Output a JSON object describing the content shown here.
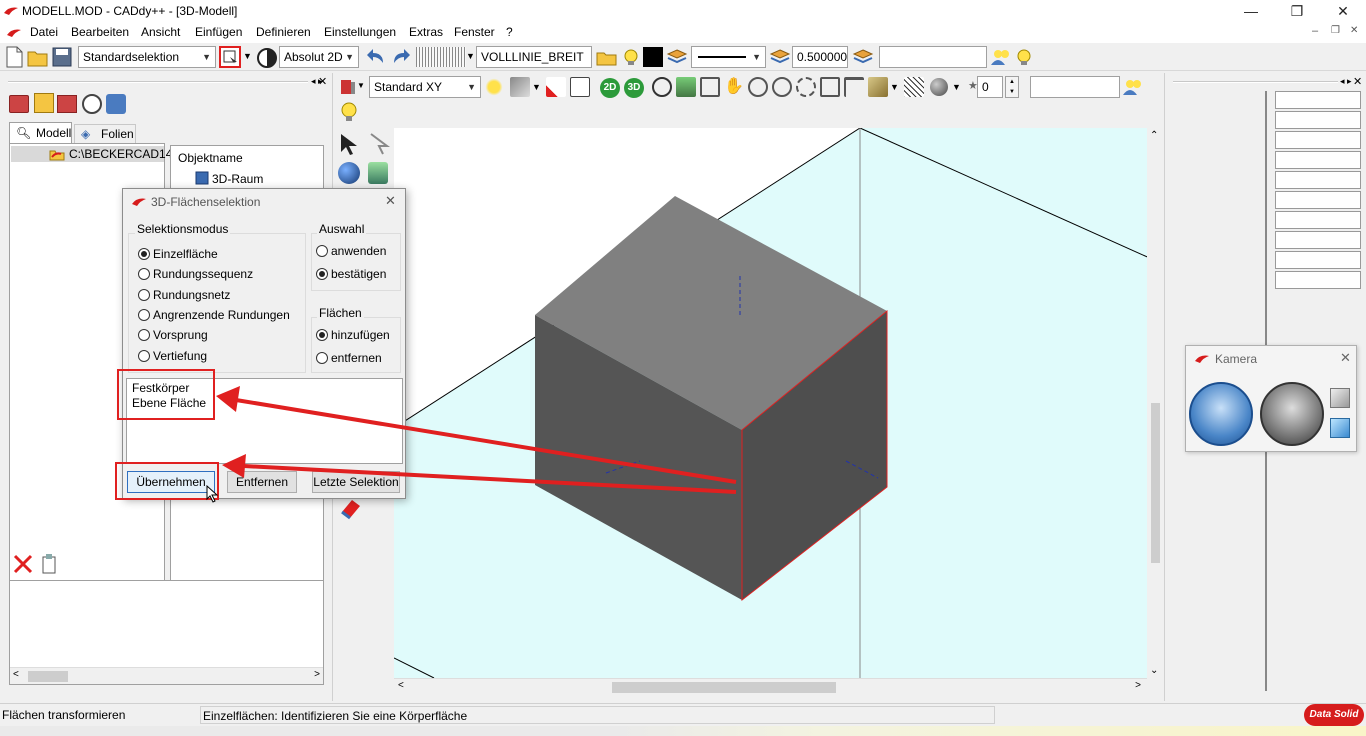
{
  "window": {
    "title": "MODELL.MOD  -  CADdy++ - [3D-Modell]",
    "minimize": "—",
    "restore": "❐",
    "close": "✕"
  },
  "menu": {
    "items": [
      "Datei",
      "Bearbeiten",
      "Ansicht",
      "Einfügen",
      "Definieren",
      "Einstellungen",
      "Extras",
      "Fenster",
      "?"
    ],
    "mdi_min": "–",
    "mdi_restore": "❐",
    "mdi_close": "✕"
  },
  "toolbar": {
    "selection_mode": "Standardselektion",
    "coord_mode": "Absolut 2D",
    "linetype": "VOLLLINIE_BREIT",
    "line_width": "0.500000",
    "layer_value": ""
  },
  "viewport_toolbar": {
    "view": "Standard XY",
    "btn_2d": "2D",
    "btn_3d": "3D",
    "spinner_value": "0",
    "input_value": ""
  },
  "left_panel": {
    "tabs": [
      "Modell",
      "Folien"
    ],
    "tree_root": "C:\\BECKERCAD14",
    "object_header": "Objektname",
    "object_item": "3D-Raum"
  },
  "dialog": {
    "title": "3D-Flächenselektion",
    "group_mode": "Selektionsmodus",
    "modes": [
      {
        "label": "Einzelfläche",
        "checked": true
      },
      {
        "label": "Rundungssequenz",
        "checked": false
      },
      {
        "label": "Rundungsnetz",
        "checked": false
      },
      {
        "label": "Angrenzende Rundungen",
        "checked": false
      },
      {
        "label": "Vorsprung",
        "checked": false
      },
      {
        "label": "Vertiefung",
        "checked": false
      }
    ],
    "group_auswahl": "Auswahl",
    "auswahl": [
      {
        "label": "anwenden",
        "checked": false
      },
      {
        "label": "bestätigen",
        "checked": true
      }
    ],
    "group_flaechen": "Flächen",
    "flaechen": [
      {
        "label": "hinzufügen",
        "checked": true
      },
      {
        "label": "entfernen",
        "checked": false
      }
    ],
    "list_lines": [
      "Festkörper",
      "Ebene Fläche"
    ],
    "btn_apply": "Übernehmen",
    "btn_remove": "Entfernen",
    "btn_last": "Letzte Selektion"
  },
  "camera": {
    "title": "Kamera"
  },
  "status": {
    "left": "Flächen transformieren",
    "main": "Einzelflächen: Identifizieren Sie eine Körperfläche",
    "logo": "Data Solid"
  },
  "colors": {
    "accent_red": "#e02020",
    "floor": "#e0fbfb",
    "cube_top": "#808080",
    "cube_left": "#555555",
    "cube_right": "#4e4e4e"
  }
}
